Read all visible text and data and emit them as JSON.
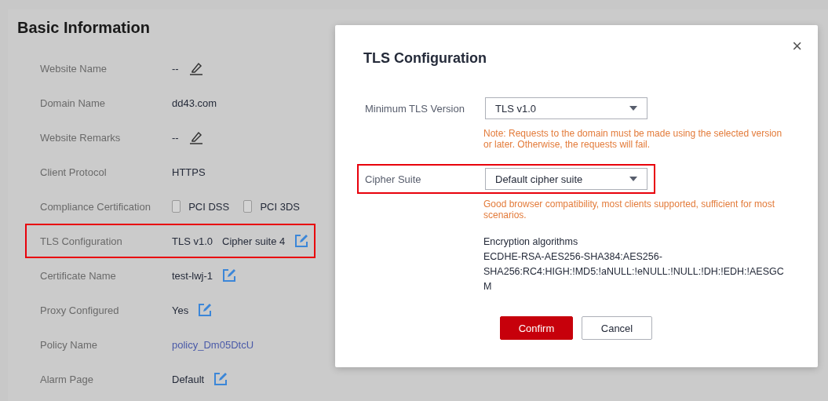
{
  "section": {
    "title": "Basic Information"
  },
  "fields": [
    {
      "label": "Website Name",
      "kind": "text",
      "value": "--",
      "edit": {
        "kind": "pencil"
      }
    },
    {
      "label": "Domain Name",
      "kind": "text",
      "value": "dd43.com"
    },
    {
      "label": "Website Remarks",
      "kind": "text",
      "value": "--",
      "edit": {
        "kind": "pencil"
      }
    },
    {
      "label": "Client Protocol",
      "kind": "text",
      "value": "HTTPS"
    },
    {
      "label": "Compliance Certification",
      "kind": "checkboxes",
      "options": [
        {
          "label": "PCI DSS",
          "checked": false
        },
        {
          "label": "PCI 3DS",
          "checked": false
        }
      ]
    },
    {
      "label": "TLS Configuration",
      "kind": "pair",
      "values": [
        "TLS v1.0",
        "Cipher suite 4"
      ],
      "edit": {
        "kind": "box"
      },
      "highlighted": true
    },
    {
      "label": "Certificate Name",
      "kind": "text",
      "value": "test-lwj-1",
      "edit": {
        "kind": "box"
      }
    },
    {
      "label": "Proxy Configured",
      "kind": "text",
      "value": "Yes",
      "edit": {
        "kind": "box"
      }
    },
    {
      "label": "Policy Name",
      "kind": "link",
      "value": "policy_Dm05DtcU"
    },
    {
      "label": "Alarm Page",
      "kind": "text",
      "value": "Default",
      "edit": {
        "kind": "box"
      }
    }
  ],
  "dialog": {
    "title": "TLS Configuration",
    "close": "×",
    "rows": [
      {
        "label": "Minimum TLS Version",
        "value": "TLS v1.0",
        "note": "Note: Requests to the domain must be made using the selected version or later. Otherwise, the requests will fail.",
        "highlighted": false
      },
      {
        "label": "Cipher Suite",
        "value": "Default cipher suite",
        "note": "Good browser compatibility, most clients supported, sufficient for most scenarios.",
        "highlighted": true
      }
    ],
    "algorithms_title": "Encryption algorithms",
    "algorithms": "ECDHE-RSA-AES256-SHA384:AES256-SHA256:RC4:HIGH:!MD5:!aNULL:!eNULL:!NULL:!DH:!EDH:!AESGCM",
    "buttons": [
      {
        "label": "Confirm",
        "kind": "primary"
      },
      {
        "label": "Cancel",
        "kind": "secondary"
      }
    ]
  }
}
